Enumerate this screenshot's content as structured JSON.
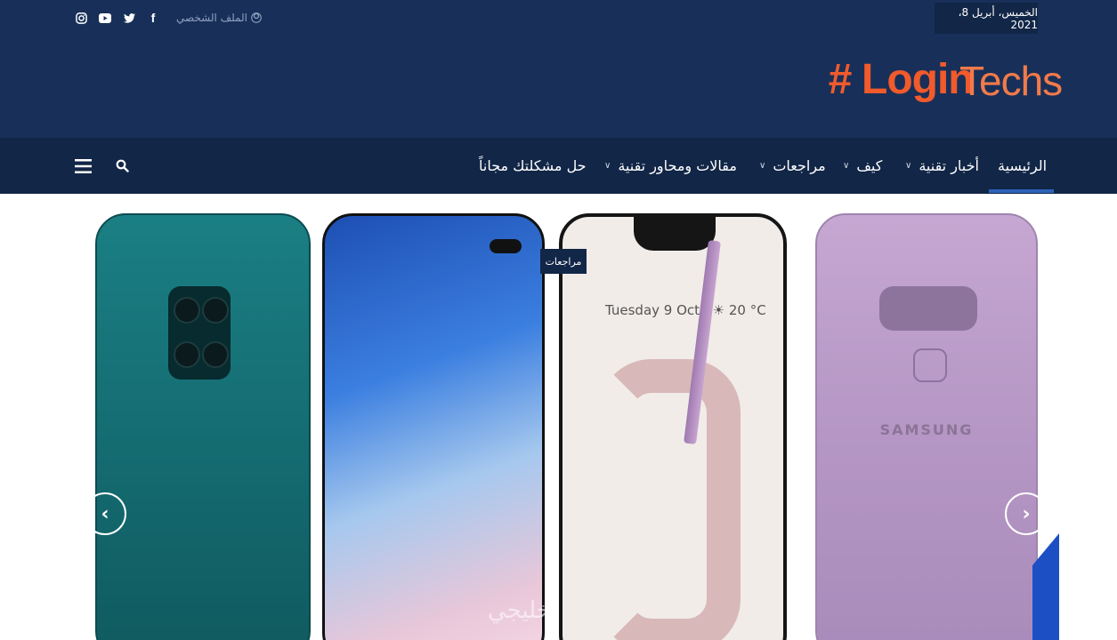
{
  "header": {
    "date": "الخميس، أبريل 8، 2021",
    "profile_label": "الملف الشخصي",
    "logo": {
      "hash": "#",
      "login": "Login",
      "techs": "Techs"
    },
    "social": [
      {
        "icon": "instagram-icon"
      },
      {
        "icon": "youtube-icon"
      },
      {
        "icon": "twitter-icon"
      },
      {
        "icon": "facebook-icon"
      }
    ]
  },
  "nav": {
    "items": [
      {
        "label": "الرئيسية",
        "dropdown": false
      },
      {
        "label": "أخبار تقنية",
        "dropdown": true
      },
      {
        "label": "كيف",
        "dropdown": true
      },
      {
        "label": "مراجعات",
        "dropdown": true
      },
      {
        "label": "مقالات ومحاور تقنية",
        "dropdown": true
      },
      {
        "label": "حل مشكلتك مجاناً",
        "dropdown": false
      }
    ],
    "active_index": 0
  },
  "slider": {
    "category_tag": "مراجعات",
    "phone3_time": "Tuesday 9 Oct | ☀ 20 °C",
    "phone4_brand": "SAMSUNG",
    "watermark": "خليجي"
  },
  "colors": {
    "header_bg": "#183059",
    "nav_bg": "#122647",
    "accent": "#2d62b8",
    "logo": "#f15a2b"
  }
}
